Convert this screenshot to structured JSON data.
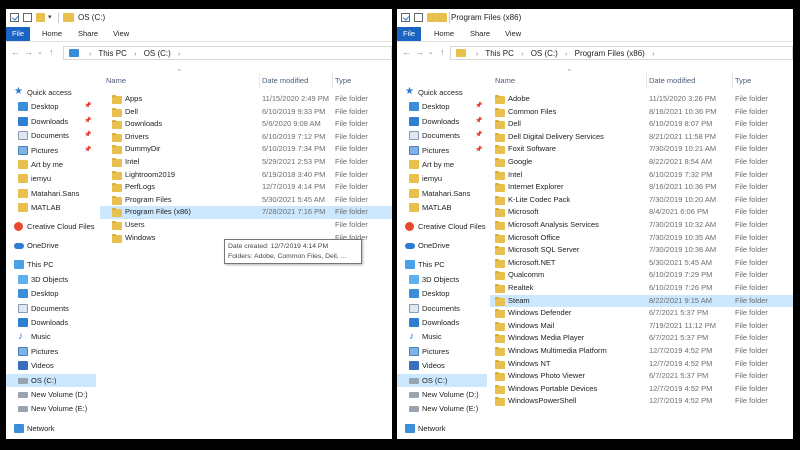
{
  "ribbon_tabs": [
    "File",
    "Home",
    "Share",
    "View"
  ],
  "nav_pane": {
    "quick_access": "Quick access",
    "items": [
      {
        "label": "Desktop",
        "icon": "desktop-icon",
        "pinned": true
      },
      {
        "label": "Downloads",
        "icon": "downloads-icon",
        "pinned": true
      },
      {
        "label": "Documents",
        "icon": "documents-icon",
        "pinned": true
      },
      {
        "label": "Pictures",
        "icon": "pictures-icon",
        "pinned": true
      },
      {
        "label": "Art by me",
        "icon": "folder-icon",
        "pinned": false
      },
      {
        "label": "iemyu",
        "icon": "folder-icon",
        "pinned": false
      },
      {
        "label": "Matahari.Sans",
        "icon": "folder-icon",
        "pinned": false
      },
      {
        "label": "MATLAB",
        "icon": "folder-icon",
        "pinned": false
      }
    ],
    "creative_cloud": "Creative Cloud Files",
    "onedrive": "OneDrive",
    "this_pc": "This PC",
    "pc_items": [
      "3D Objects",
      "Desktop",
      "Documents",
      "Downloads",
      "Music",
      "Pictures",
      "Videos",
      "OS (C:)",
      "New Volume (D:)",
      "New Volume (E:)"
    ],
    "network": "Network"
  },
  "left_window": {
    "title": "OS (C:)",
    "breadcrumb": [
      "This PC",
      "OS (C:)"
    ],
    "columns": {
      "name": "Name",
      "date": "Date modified",
      "type": "Type"
    },
    "files": [
      {
        "name": "Apps",
        "date": "11/15/2020 2:49 PM",
        "type": "File folder"
      },
      {
        "name": "Dell",
        "date": "6/10/2019 9:33 PM",
        "type": "File folder"
      },
      {
        "name": "Downloads",
        "date": "5/6/2020 9:08 AM",
        "type": "File folder"
      },
      {
        "name": "Drivers",
        "date": "6/10/2019 7:12 PM",
        "type": "File folder"
      },
      {
        "name": "DummyDir",
        "date": "6/10/2019 7:34 PM",
        "type": "File folder"
      },
      {
        "name": "Intel",
        "date": "5/29/2021 2:53 PM",
        "type": "File folder"
      },
      {
        "name": "Lightroom2019",
        "date": "6/19/2018 3:40 PM",
        "type": "File folder"
      },
      {
        "name": "PerfLogs",
        "date": "12/7/2019 4:14 PM",
        "type": "File folder"
      },
      {
        "name": "Program Files",
        "date": "5/30/2021 5:45 AM",
        "type": "File folder"
      },
      {
        "name": "Program Files (x86)",
        "date": "7/28/2021 7:16 PM",
        "type": "File folder"
      },
      {
        "name": "Users",
        "date": "",
        "type": "File folder"
      },
      {
        "name": "Windows",
        "date": "",
        "type": "File folder"
      }
    ],
    "selected_index": 9,
    "tooltip": {
      "line1": "Date created: 12/7/2019 4:14 PM",
      "line2": "Folders: Adobe, Common Files, Dell, ..."
    }
  },
  "right_window": {
    "title": "Program Files (x86)",
    "breadcrumb": [
      "This PC",
      "OS (C:)",
      "Program Files (x86)"
    ],
    "columns": {
      "name": "Name",
      "date": "Date modified",
      "type": "Type"
    },
    "files": [
      {
        "name": "Adobe",
        "date": "11/15/2020 3:26 PM",
        "type": "File folder"
      },
      {
        "name": "Common Files",
        "date": "8/16/2021 10:36 PM",
        "type": "File folder"
      },
      {
        "name": "Dell",
        "date": "6/10/2019 8:07 PM",
        "type": "File folder"
      },
      {
        "name": "Dell Digital Delivery Services",
        "date": "8/21/2021 11:58 PM",
        "type": "File folder"
      },
      {
        "name": "Foxit Software",
        "date": "7/30/2019 10:21 AM",
        "type": "File folder"
      },
      {
        "name": "Google",
        "date": "8/22/2021 8:54 AM",
        "type": "File folder"
      },
      {
        "name": "Intel",
        "date": "6/10/2019 7:32 PM",
        "type": "File folder"
      },
      {
        "name": "Internet Explorer",
        "date": "8/16/2021 10:36 PM",
        "type": "File folder"
      },
      {
        "name": "K-Lite Codec Pack",
        "date": "7/30/2019 10:20 AM",
        "type": "File folder"
      },
      {
        "name": "Microsoft",
        "date": "8/4/2021 6:06 PM",
        "type": "File folder"
      },
      {
        "name": "Microsoft Analysis Services",
        "date": "7/30/2019 10:32 AM",
        "type": "File folder"
      },
      {
        "name": "Microsoft Office",
        "date": "7/30/2019 10:35 AM",
        "type": "File folder"
      },
      {
        "name": "Microsoft SQL Server",
        "date": "7/30/2019 10:36 AM",
        "type": "File folder"
      },
      {
        "name": "Microsoft.NET",
        "date": "5/30/2021 5:45 AM",
        "type": "File folder"
      },
      {
        "name": "Qualcomm",
        "date": "6/10/2019 7:29 PM",
        "type": "File folder"
      },
      {
        "name": "Realtek",
        "date": "6/10/2019 7:26 PM",
        "type": "File folder"
      },
      {
        "name": "Steam",
        "date": "8/22/2021 9:15 AM",
        "type": "File folder"
      },
      {
        "name": "Windows Defender",
        "date": "6/7/2021 5:37 PM",
        "type": "File folder"
      },
      {
        "name": "Windows Mail",
        "date": "7/19/2021 11:12 PM",
        "type": "File folder"
      },
      {
        "name": "Windows Media Player",
        "date": "6/7/2021 5:37 PM",
        "type": "File folder"
      },
      {
        "name": "Windows Multimedia Platform",
        "date": "12/7/2019 4:52 PM",
        "type": "File folder"
      },
      {
        "name": "Windows NT",
        "date": "12/7/2019 4:52 PM",
        "type": "File folder"
      },
      {
        "name": "Windows Photo Viewer",
        "date": "6/7/2021 5:37 PM",
        "type": "File folder"
      },
      {
        "name": "Windows Portable Devices",
        "date": "12/7/2019 4:52 PM",
        "type": "File folder"
      },
      {
        "name": "WindowsPowerShell",
        "date": "12/7/2019 4:52 PM",
        "type": "File folder"
      }
    ],
    "selected_index": 16
  },
  "icons": {
    "back": "back-arrow-icon",
    "forward": "forward-arrow-icon",
    "recent": "chevron-down-icon",
    "up": "up-arrow-icon"
  },
  "colors": {
    "accent": "#1a64c4",
    "selection": "#cce8ff",
    "folder": "#e8c04e"
  }
}
